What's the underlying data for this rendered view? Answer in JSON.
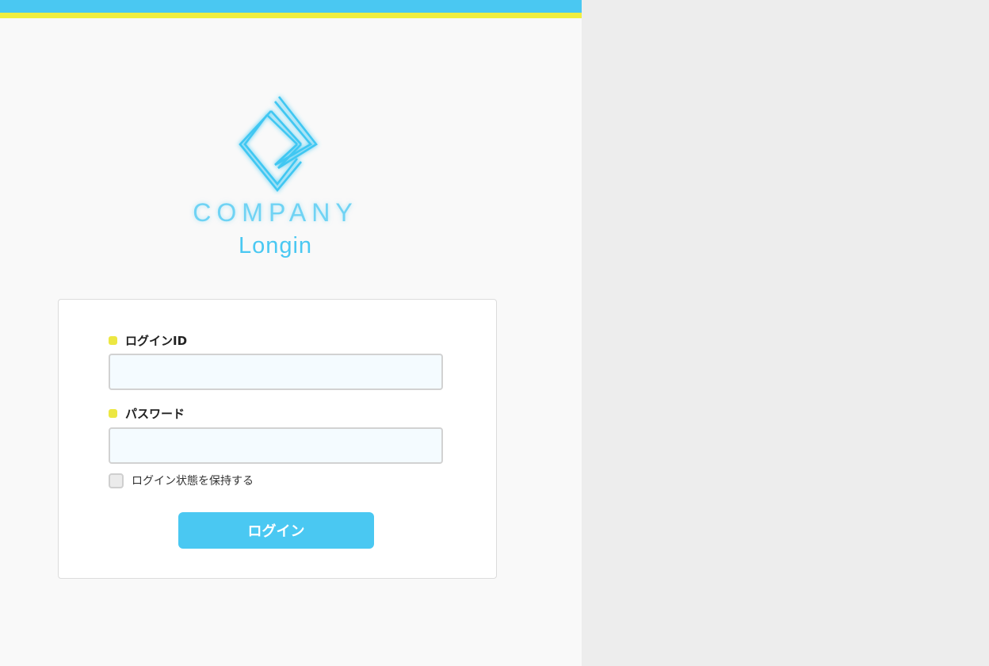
{
  "header": {
    "accent_color": "#4ac8f2",
    "stripe_color": "#f0ee3e"
  },
  "brand": {
    "logo_icon": "diamond-chevron-logo-icon",
    "name": "COMPANY",
    "subtitle": "Longin"
  },
  "form": {
    "login_id_label": "ログインID",
    "login_id_value": "",
    "password_label": "パスワード",
    "password_value": "",
    "keep_logged_in_label": "ログイン状態を保持する",
    "keep_logged_in_checked": false,
    "submit_label": "ログイン"
  }
}
